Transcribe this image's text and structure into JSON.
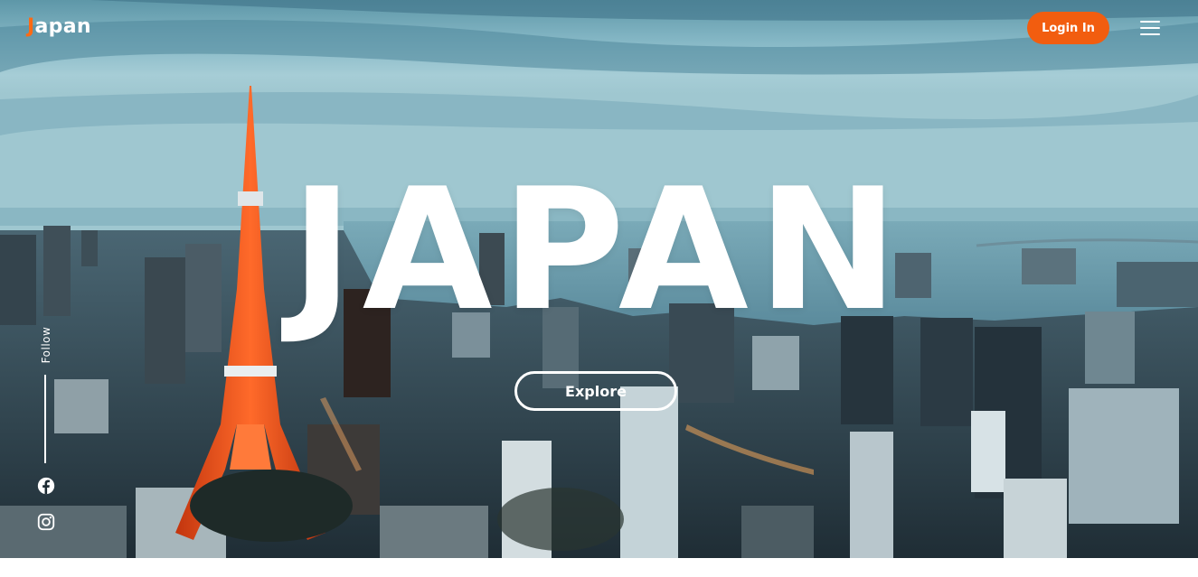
{
  "header": {
    "logo_first_letter": "J",
    "logo_rest": "apan",
    "login_label": "Login In",
    "menu_icon": "hamburger-menu-icon"
  },
  "hero": {
    "title": "JAPAN",
    "explore_label": "Explore"
  },
  "follow": {
    "label": "Follow",
    "icons": [
      "facebook-icon",
      "instagram-icon"
    ]
  },
  "colors": {
    "accent": "#f25d0f",
    "logo_accent": "#ff6a13",
    "text": "#ffffff"
  }
}
